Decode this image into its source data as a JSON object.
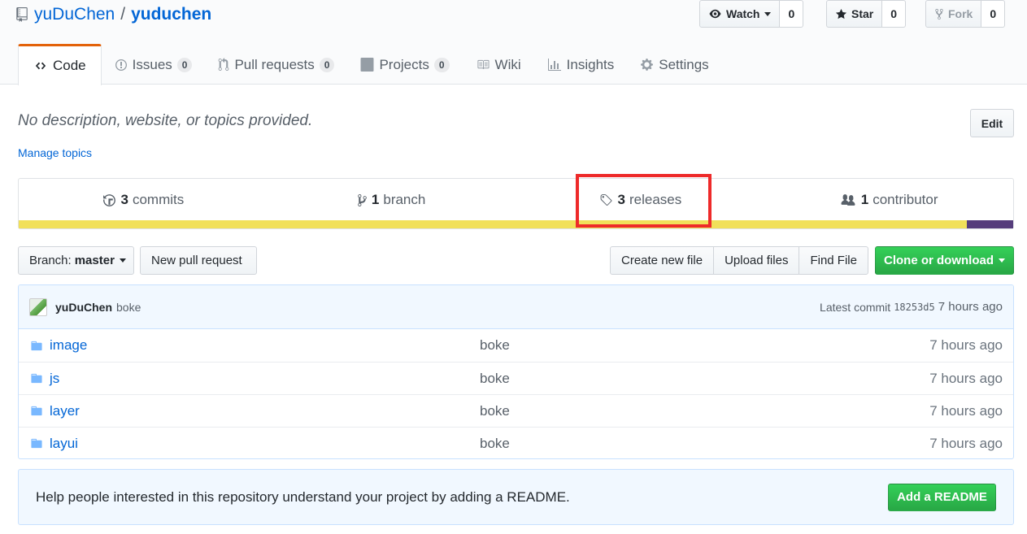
{
  "repo": {
    "owner": "yuDuChen",
    "separator": "/",
    "name": "yuduchen"
  },
  "actions": {
    "watch": {
      "label": "Watch",
      "count": "0"
    },
    "star": {
      "label": "Star",
      "count": "0"
    },
    "fork": {
      "label": "Fork",
      "count": "0"
    }
  },
  "tabs": [
    {
      "label": "Code",
      "icon": "code-icon"
    },
    {
      "label": "Issues",
      "count": "0",
      "icon": "issue-icon"
    },
    {
      "label": "Pull requests",
      "count": "0",
      "icon": "pull-request-icon"
    },
    {
      "label": "Projects",
      "count": "0",
      "icon": "project-icon"
    },
    {
      "label": "Wiki",
      "icon": "book-icon"
    },
    {
      "label": "Insights",
      "icon": "graph-icon"
    },
    {
      "label": "Settings",
      "icon": "gear-icon"
    }
  ],
  "description": "No description, website, or topics provided.",
  "manage_topics": "Manage topics",
  "edit_label": "Edit",
  "summary": {
    "commits": {
      "count": "3",
      "label": "commits"
    },
    "branches": {
      "count": "1",
      "label": "branch"
    },
    "releases": {
      "count": "3",
      "label": "releases"
    },
    "contributors": {
      "count": "1",
      "label": "contributor"
    }
  },
  "language_bar": [
    {
      "color": "#f1e05a",
      "percent": 95.3
    },
    {
      "color": "#563d7c",
      "percent": 4.7
    }
  ],
  "file_nav": {
    "branch_prefix": "Branch:",
    "branch": "master",
    "new_pr": "New pull request",
    "create_file": "Create new file",
    "upload": "Upload files",
    "find": "Find File",
    "clone": "Clone or download"
  },
  "latest_commit": {
    "author": "yuDuChen",
    "message": "boke",
    "prefix": "Latest commit",
    "sha": "18253d5",
    "age": "7 hours ago"
  },
  "files": [
    {
      "name": "image",
      "message": "boke",
      "age": "7 hours ago"
    },
    {
      "name": "js",
      "message": "boke",
      "age": "7 hours ago"
    },
    {
      "name": "layer",
      "message": "boke",
      "age": "7 hours ago"
    },
    {
      "name": "layui",
      "message": "boke",
      "age": "7 hours ago"
    }
  ],
  "readme_prompt": {
    "text": "Help people interested in this repository understand your project by adding a README.",
    "button": "Add a README"
  },
  "colors": {
    "link": "#0366d6",
    "accent_tab": "#e36209",
    "primary_button": "#28a745",
    "highlight_box": "#ee2a2a"
  }
}
